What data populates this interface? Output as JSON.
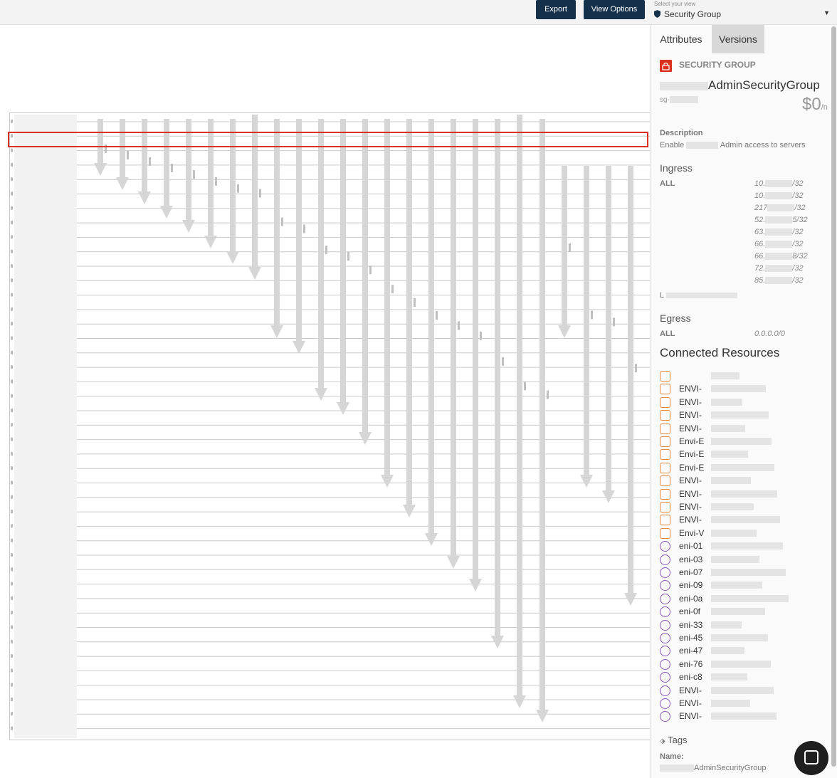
{
  "toolbar": {
    "export_label": "Export",
    "view_options_label": "View Options",
    "view_select_caption": "Select your view",
    "view_select_value": "Security Group"
  },
  "panel": {
    "tabs": [
      {
        "label": "Attributes",
        "active": true
      },
      {
        "label": "Versions",
        "active": false
      }
    ],
    "type_label": "SECURITY GROUP",
    "name": "AdminSecurityGroup",
    "id_prefix": "sg-",
    "cost": "$0",
    "cost_suffix": "/n",
    "description_heading": "Description",
    "description_prefix": "Enable",
    "description_suffix": "Admin access to servers",
    "ingress_heading": "Ingress",
    "ingress_protocol": "ALL",
    "ingress_rules": [
      {
        "start": "10.",
        "end": "/32"
      },
      {
        "start": "10.",
        "end": "/32"
      },
      {
        "start": "217",
        "end": "/32"
      },
      {
        "start": "52.",
        "end": "5/32"
      },
      {
        "start": "63.",
        "end": "/32"
      },
      {
        "start": "66.",
        "end": "/32"
      },
      {
        "start": "66.",
        "end": "8/32"
      },
      {
        "start": "72.",
        "end": "/32"
      },
      {
        "start": "85.",
        "end": "/32"
      }
    ],
    "ingress_extra": "L",
    "egress_heading": "Egress",
    "egress_protocol": "ALL",
    "egress_rule": "0.0.0.0/0",
    "connected_heading": "Connected Resources",
    "resources": [
      {
        "label": "",
        "kind": "instance"
      },
      {
        "label": "ENVI-",
        "kind": "instance"
      },
      {
        "label": "ENVI-",
        "kind": "instance"
      },
      {
        "label": "ENVI-",
        "kind": "instance"
      },
      {
        "label": "ENVI-",
        "kind": "instance"
      },
      {
        "label": "Envi-E",
        "kind": "instance"
      },
      {
        "label": "Envi-E",
        "kind": "instance"
      },
      {
        "label": "Envi-E",
        "kind": "instance"
      },
      {
        "label": "ENVI-",
        "kind": "instance"
      },
      {
        "label": "ENVI-",
        "kind": "instance"
      },
      {
        "label": "ENVI-",
        "kind": "instance"
      },
      {
        "label": "ENVI-",
        "kind": "instance"
      },
      {
        "label": "Envi-V",
        "kind": "instance"
      },
      {
        "label": "eni-01",
        "kind": "eni"
      },
      {
        "label": "eni-03",
        "kind": "eni"
      },
      {
        "label": "eni-07",
        "kind": "eni"
      },
      {
        "label": "eni-09",
        "kind": "eni"
      },
      {
        "label": "eni-0a",
        "kind": "eni"
      },
      {
        "label": "eni-0f",
        "kind": "eni"
      },
      {
        "label": "eni-33",
        "kind": "eni"
      },
      {
        "label": "eni-45",
        "kind": "eni"
      },
      {
        "label": "eni-47",
        "kind": "eni"
      },
      {
        "label": "eni-76",
        "kind": "eni"
      },
      {
        "label": "eni-c8",
        "kind": "eni"
      },
      {
        "label": "ENVI-",
        "kind": "eni"
      },
      {
        "label": "ENVI-",
        "kind": "eni"
      },
      {
        "label": "ENVI-",
        "kind": "eni"
      }
    ],
    "tags_heading": "Tags",
    "tag_key": "Name:",
    "tag_value": "AdminSecurityGroup"
  },
  "colors": {
    "navy": "#14304a",
    "highlight": "#d9321e",
    "arrow": "#d6d6d6",
    "instance_icon": "#e8893a",
    "eni_icon": "#8a57b8"
  },
  "icons": [
    "shield-icon",
    "caret-down-icon",
    "lock-icon",
    "tag-icon",
    "chat-icon",
    "instance-icon",
    "network-interface-icon"
  ]
}
